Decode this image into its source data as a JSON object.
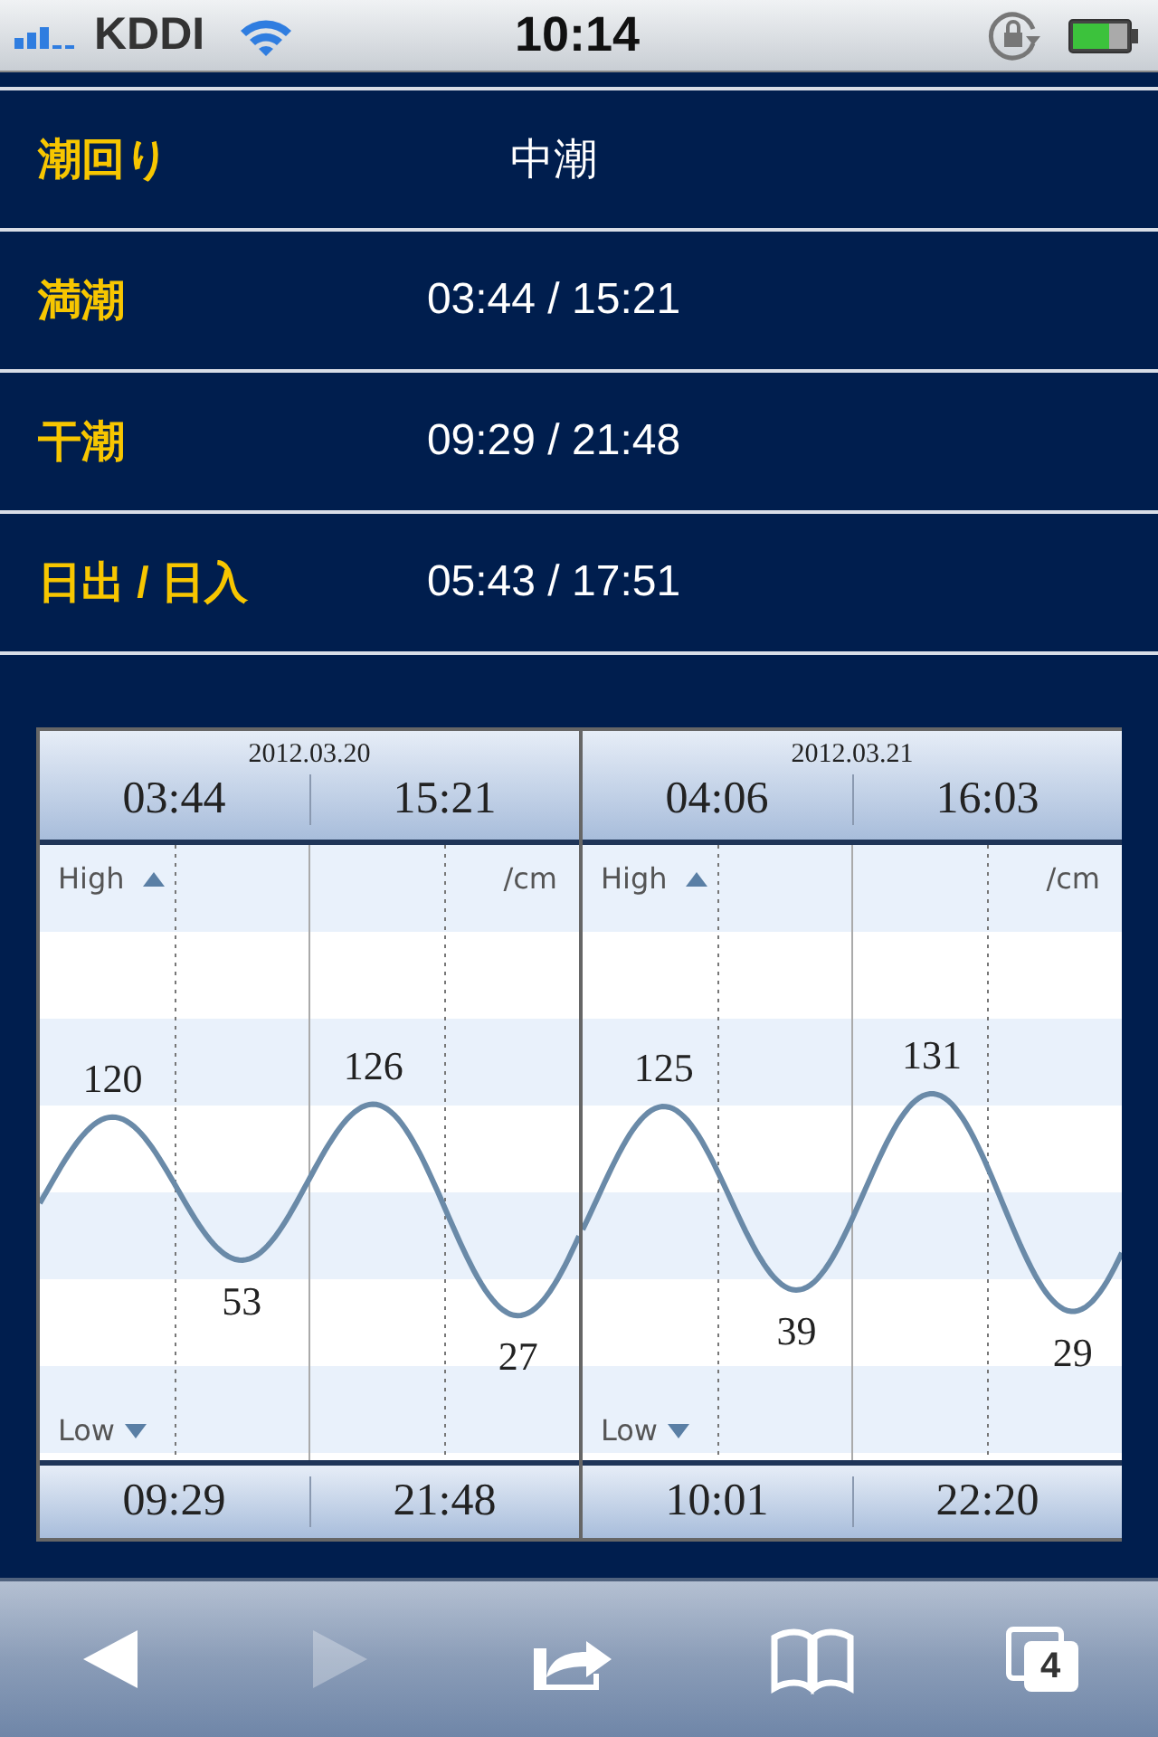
{
  "status_bar": {
    "carrier": "KDDI",
    "time": "10:14"
  },
  "info_rows": [
    {
      "label": "潮回り",
      "value": "中潮"
    },
    {
      "label": "満潮",
      "value": "03:44 / 15:21"
    },
    {
      "label": "干潮",
      "value": "09:29 / 21:48"
    },
    {
      "label": "日出 / 日入",
      "value": "05:43 / 17:51"
    }
  ],
  "tide_chart": {
    "days": [
      {
        "date": "2012.03.20",
        "high_times": [
          "03:44",
          "15:21"
        ],
        "low_times": [
          "09:29",
          "21:48"
        ],
        "high_label": "High",
        "low_label": "Low",
        "unit": "/cm",
        "extremes": [
          {
            "kind": "high",
            "value": "120"
          },
          {
            "kind": "low",
            "value": "53"
          },
          {
            "kind": "high",
            "value": "126"
          },
          {
            "kind": "low",
            "value": "27"
          }
        ]
      },
      {
        "date": "2012.03.21",
        "high_times": [
          "04:06",
          "16:03"
        ],
        "low_times": [
          "10:01",
          "22:20"
        ],
        "high_label": "High",
        "low_label": "Low",
        "unit": "/cm",
        "extremes": [
          {
            "kind": "high",
            "value": "125"
          },
          {
            "kind": "low",
            "value": "39"
          },
          {
            "kind": "high",
            "value": "131"
          },
          {
            "kind": "low",
            "value": "29"
          }
        ]
      }
    ]
  },
  "toolbar": {
    "back_disabled": false,
    "forward_disabled": true,
    "tab_count": "4"
  }
}
